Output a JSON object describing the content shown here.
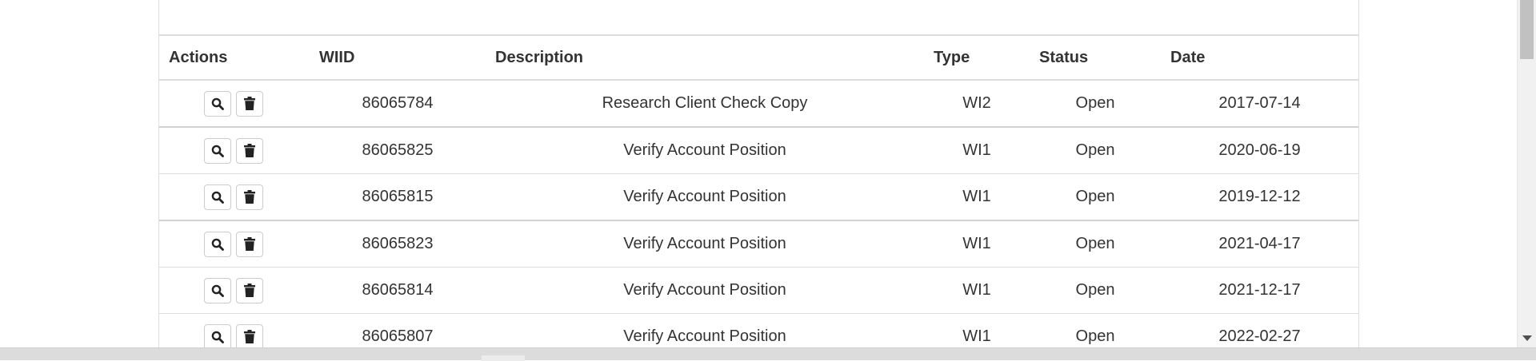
{
  "table": {
    "headers": {
      "actions": "Actions",
      "wiid": "WIID",
      "description": "Description",
      "type": "Type",
      "status": "Status",
      "date": "Date"
    },
    "rows": [
      {
        "wiid": "86065784",
        "description": "Research Client Check Copy",
        "type": "WI2",
        "status": "Open",
        "date": "2017-07-14"
      },
      {
        "wiid": "86065825",
        "description": "Verify Account Position",
        "type": "WI1",
        "status": "Open",
        "date": "2020-06-19"
      },
      {
        "wiid": "86065815",
        "description": "Verify Account Position",
        "type": "WI1",
        "status": "Open",
        "date": "2019-12-12"
      },
      {
        "wiid": "86065823",
        "description": "Verify Account Position",
        "type": "WI1",
        "status": "Open",
        "date": "2021-04-17"
      },
      {
        "wiid": "86065814",
        "description": "Verify Account Position",
        "type": "WI1",
        "status": "Open",
        "date": "2021-12-17"
      },
      {
        "wiid": "86065807",
        "description": "Verify Account Position",
        "type": "WI1",
        "status": "Open",
        "date": "2022-02-27"
      }
    ],
    "row_action_icons": [
      "search-icon",
      "trash-icon"
    ]
  },
  "colors": {
    "border": "#dddddd",
    "text": "#333333",
    "icon": "#222222",
    "scrollbar_thumb": "#c1c1c1"
  }
}
